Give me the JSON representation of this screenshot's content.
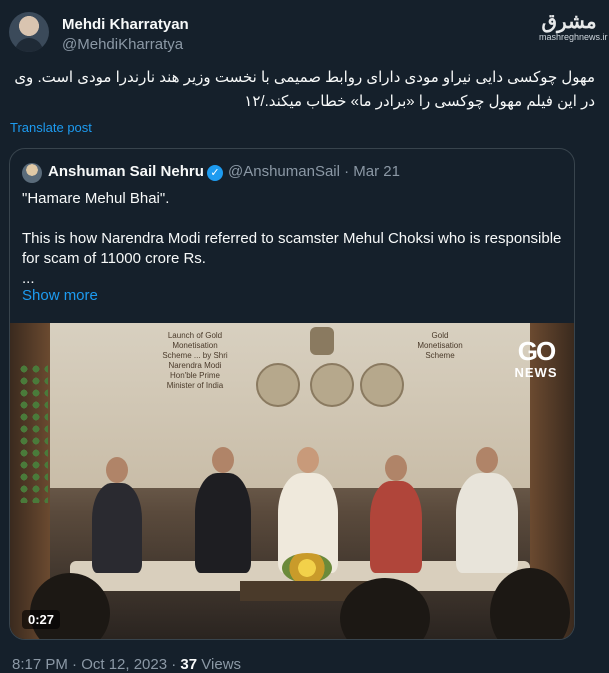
{
  "author": {
    "name": "Mehdi Kharratyan",
    "handle": "@MehdiKharratya",
    "avatar_icon": "avatar"
  },
  "watermark": {
    "logo": "مشرق",
    "url": "mashreghnews.ir"
  },
  "tweet": {
    "text": "مهول چوکسی دایی نیراو مودی دارای روابط صمیمی با نخست وزیر هند نارندرا مودی است. وی در این فیلم مهول چوکسی را «برادر ما» خطاب میکند./۱۲",
    "translate_label": "Translate post"
  },
  "quote": {
    "author_name": "Anshuman Sail Nehru",
    "verified_icon": "verified-badge-icon",
    "handle_date": "@AnshumanSail · Mar 21",
    "text": "\"Hamare Mehul Bhai\".\n\nThis is how Narendra Modi referred to scamster Mehul Choksi who is responsible for scam of 11000 crore Rs.\n...",
    "show_more_label": "Show more"
  },
  "video": {
    "channel_logo": "GO",
    "channel_sub": "NEWS",
    "duration": "0:27",
    "banner_left": "Launch of Gold Monetisation Scheme ... by Shri Narendra Modi Hon'ble Prime Minister of India",
    "banner_right": "Gold Monetisation Scheme"
  },
  "footer": {
    "time": "8:17 PM · Oct 12, 2023 ·",
    "views_count": "37",
    "views_label": "Views"
  },
  "colors": {
    "background": "#15202b",
    "accent": "#1d9bf0",
    "muted": "#8b98a5"
  }
}
